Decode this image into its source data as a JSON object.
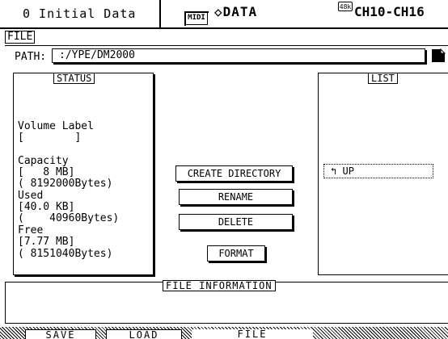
{
  "header": {
    "scene": "0 Initial Data",
    "midi_indicator": "MIDI",
    "page_icon": "diamond-icon",
    "page_name": "DATA",
    "fs_indicator": "48k",
    "channel_range": "CH10-CH16"
  },
  "file_tab_label": "FILE",
  "path": {
    "label": "PATH:",
    "value": ":/YPE/DM2000"
  },
  "status": {
    "title": "STATUS",
    "volume_label_title": "Volume Label",
    "volume_label_value": "[        ]",
    "capacity_title": "Capacity",
    "capacity_mb": "[   8 MB]",
    "capacity_bytes": "( 8192000Bytes)",
    "used_title": "Used",
    "used_kb": "[40.0 KB]",
    "used_bytes": "(    40960Bytes)",
    "free_title": "Free",
    "free_mb": "[7.77 MB]",
    "free_bytes": "( 8151040Bytes)"
  },
  "buttons": {
    "create_directory": "CREATE DIRECTORY",
    "rename": "RENAME",
    "delete": "DELETE",
    "format": "FORMAT"
  },
  "list": {
    "title": "LIST",
    "items": [
      {
        "icon": "return-up-arrow-icon",
        "label": "UP"
      }
    ]
  },
  "file_information": {
    "title": "FILE INFORMATION"
  },
  "tabs": [
    {
      "label": "SAVE",
      "active": false
    },
    {
      "label": "LOAD",
      "active": false
    },
    {
      "label": "FILE",
      "active": true
    }
  ]
}
